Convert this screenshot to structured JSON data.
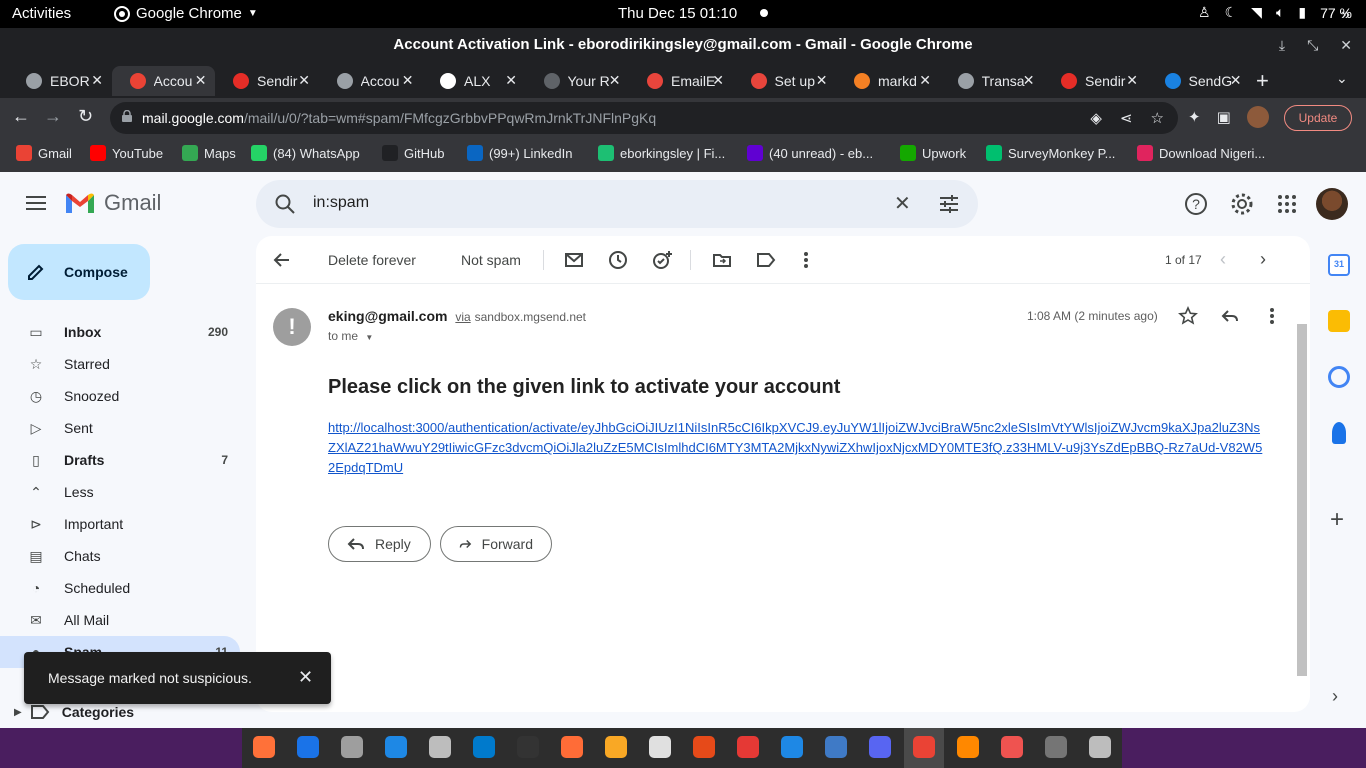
{
  "system": {
    "activities": "Activities",
    "app_menu": "Google Chrome",
    "clock": "Thu Dec 15  01:10",
    "battery": "77 %"
  },
  "window": {
    "title": "Account Activation Link - eborodirikingsley@gmail.com - Gmail - Google Chrome"
  },
  "tabs": [
    {
      "label": "EBOR",
      "color": "#9aa0a6"
    },
    {
      "label": "Accou",
      "color": "#ea4335"
    },
    {
      "label": "Sendir",
      "color": "#e52d27"
    },
    {
      "label": "Accou",
      "color": "#9aa0a6"
    },
    {
      "label": "ALX",
      "color": "#ffffff"
    },
    {
      "label": "Your R",
      "color": "#5f6368"
    },
    {
      "label": "EmailE",
      "color": "#e8453c"
    },
    {
      "label": "Set up",
      "color": "#e8453c"
    },
    {
      "label": "markd",
      "color": "#f48024"
    },
    {
      "label": "Transa",
      "color": "#9aa0a6"
    },
    {
      "label": "Sendir",
      "color": "#e52d27"
    },
    {
      "label": "SendG",
      "color": "#1a82e2"
    }
  ],
  "omnibox": {
    "host": "mail.google.com",
    "path": "/mail/u/0/?tab=wm#spam/FMfcgzGrbbvPPqwRmJrnkTrJNFlnPgKq"
  },
  "update_label": "Update",
  "bookmarks": [
    {
      "label": "Gmail",
      "color": "#ea4335"
    },
    {
      "label": "YouTube",
      "color": "#ff0000"
    },
    {
      "label": "Maps",
      "color": "#34a853"
    },
    {
      "label": "(84) WhatsApp",
      "color": "#25d366"
    },
    {
      "label": "GitHub",
      "color": "#202124"
    },
    {
      "label": "(99+) LinkedIn",
      "color": "#0a66c2"
    },
    {
      "label": "eborkingsley | Fi...",
      "color": "#1dbf73"
    },
    {
      "label": "(40 unread) - eb...",
      "color": "#6001d2"
    },
    {
      "label": "Upwork",
      "color": "#14a800"
    },
    {
      "label": "SurveyMonkey P...",
      "color": "#00bf6f"
    },
    {
      "label": "Download Nigeri...",
      "color": "#e0245e"
    }
  ],
  "gmail": {
    "logo_text": "Gmail",
    "search_query": "in:spam",
    "compose_label": "Compose",
    "nav": [
      {
        "label": "Inbox",
        "count": "290",
        "icon": "inbox-icon"
      },
      {
        "label": "Starred",
        "count": "",
        "icon": "star-icon"
      },
      {
        "label": "Snoozed",
        "count": "",
        "icon": "clock-icon"
      },
      {
        "label": "Sent",
        "count": "",
        "icon": "send-icon"
      },
      {
        "label": "Drafts",
        "count": "7",
        "icon": "draft-icon"
      },
      {
        "label": "Less",
        "count": "",
        "icon": "chevron-up-icon"
      },
      {
        "label": "Important",
        "count": "",
        "icon": "important-icon"
      },
      {
        "label": "Chats",
        "count": "",
        "icon": "chat-icon"
      },
      {
        "label": "Scheduled",
        "count": "",
        "icon": "scheduled-icon"
      },
      {
        "label": "All Mail",
        "count": "",
        "icon": "all-mail-icon"
      },
      {
        "label": "Spam",
        "count": "11",
        "icon": "spam-icon"
      }
    ],
    "categories_label": "Categories",
    "toolbar": {
      "delete_forever": "Delete forever",
      "not_spam": "Not spam",
      "pager": "1 of 17"
    },
    "message": {
      "sender_name": "eking@gmail.com",
      "via": "via",
      "via_domain": "sandbox.mgsend.net",
      "to": "to me",
      "time": "1:08 AM (2 minutes ago)",
      "subject": "Please click on the given link to activate your account",
      "link": "http://localhost:3000/authentication/activate/eyJhbGciOiJIUzI1NiIsInR5cCI6IkpXVCJ9.eyJuYW1lIjoiZWJvciBraW5nc2xleSIsImVtYWlsIjoiZWJvcm9kaXJpa2luZ3NsZXlAZ21haWwuY29tIiwicGFzc3dvcmQiOiJla2luZzE5MCIsImlhdCI6MTY3MTA2MjkxNywiZXhwIjoxNjcxMDY0MTE3fQ.z33HMLV-u9j3YsZdEpBBQ-Rz7aUd-V82W52EpdqTDmU",
      "reply_label": "Reply",
      "forward_label": "Forward"
    },
    "snackbar": "Message marked not suspicious."
  }
}
